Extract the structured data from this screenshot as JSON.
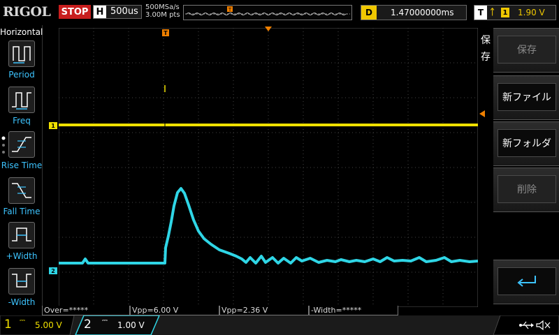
{
  "header": {
    "brand": "RIGOL",
    "run_status": "STOP",
    "horizontal": {
      "key": "H",
      "timebase": "500us"
    },
    "sample_rate": "500MSa/s",
    "memory_depth": "3.00M pts",
    "delay": {
      "key": "D",
      "value": "1.47000000ms"
    },
    "trigger": {
      "key": "T",
      "channel": "1",
      "level": "1.90 V"
    }
  },
  "left_menu": {
    "title": "Horizontal",
    "items": [
      {
        "label": "Period",
        "icon": "period-icon"
      },
      {
        "label": "Freq",
        "icon": "frequency-icon"
      },
      {
        "label": "Rise Time",
        "icon": "rise-time-icon"
      },
      {
        "label": "Fall Time",
        "icon": "fall-time-icon"
      },
      {
        "label": "+Width",
        "icon": "positive-width-icon"
      },
      {
        "label": "-Width",
        "icon": "negative-width-icon"
      }
    ]
  },
  "right_menu": {
    "title": "保存",
    "buttons": [
      {
        "label": "保存",
        "state": "disabled"
      },
      {
        "label": "新ファイル",
        "state": "enabled"
      },
      {
        "label": "新フォルダ",
        "state": "enabled"
      },
      {
        "label": "削除",
        "state": "disabled"
      },
      {
        "label": "",
        "icon": "enter-return-icon",
        "state": "enabled"
      }
    ]
  },
  "measurements": [
    {
      "text": "Over=*****"
    },
    {
      "text": "Vpp=6.00 V"
    },
    {
      "text": "Vpp=2.36 V"
    },
    {
      "text": "-Width=*****"
    }
  ],
  "channels": {
    "ch1": {
      "number": "1",
      "scale": "5.00 V",
      "color": "#f0e000"
    },
    "ch2": {
      "number": "2",
      "scale": "1.00 V",
      "color": "#2fd6e6"
    }
  },
  "waveform_markers": {
    "trigger_position_marker": "T",
    "ch1_marker": "1",
    "ch2_marker": "2"
  },
  "colors": {
    "accent_blue": "#3dc4ff",
    "stop_red": "#c81e1e",
    "ch1_yellow": "#f0e000",
    "ch2_cyan": "#2fd6e6",
    "trigger_orange": "#f08000"
  },
  "status_icons": [
    "usb-icon",
    "speaker-mute-icon"
  ]
}
